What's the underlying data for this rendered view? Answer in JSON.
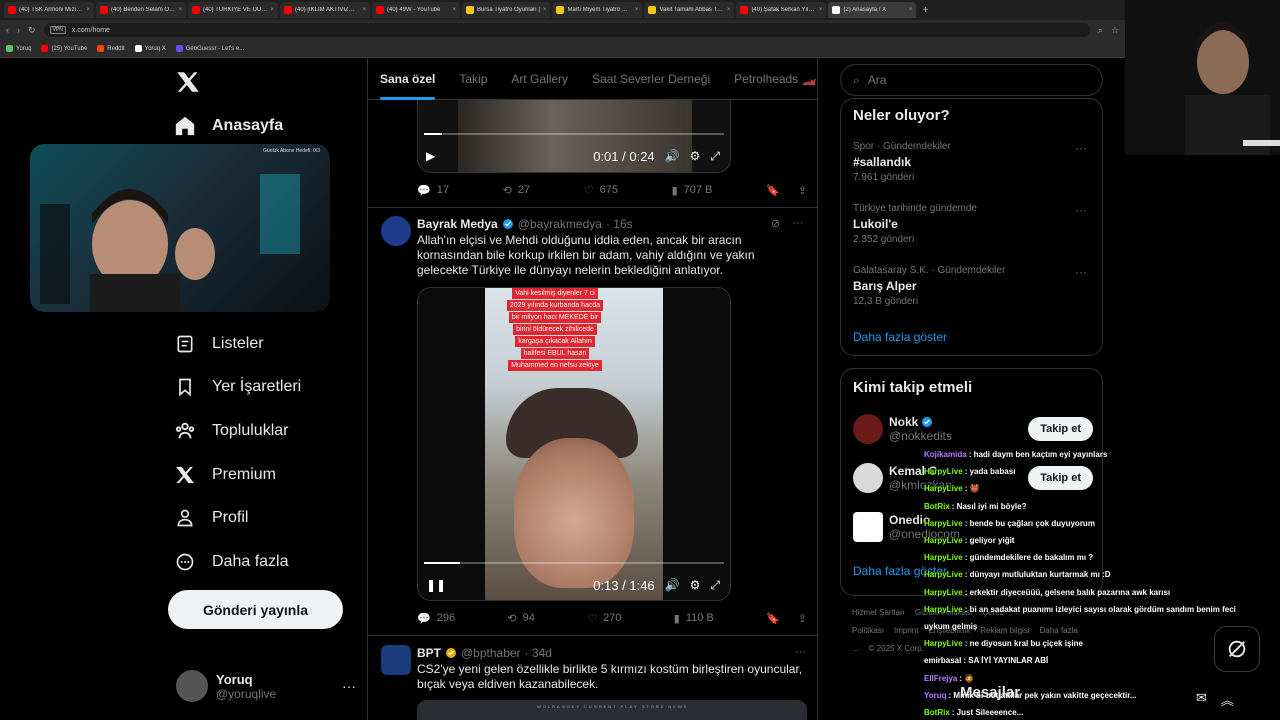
{
  "browser": {
    "tabs": [
      {
        "title": "(40) TSK Armoni Mızıkası",
        "color": "#ff0000"
      },
      {
        "title": "(40) Benden Selam Olsun",
        "color": "#ff0000"
      },
      {
        "title": "(40) TÜRKİYE VE DÜNYA",
        "color": "#ff0000"
      },
      {
        "title": "(40) [İKLİM AKTİVİZMİ] YA",
        "color": "#ff0000"
      },
      {
        "title": "(40) 49W - YouTube",
        "color": "#ff0000"
      },
      {
        "title": "Bursa Tiyatro Oyunları |",
        "color": "#f5c518"
      },
      {
        "title": "Martı Miyem Tiyatro Oyu",
        "color": "#f5c518"
      },
      {
        "title": "Vakit Tamam Abbas Tiyat",
        "color": "#f5c518"
      },
      {
        "title": "(40) Şafak Serkan Yılmaz",
        "color": "#ff0000"
      },
      {
        "title": "(2) Anasayfa / X",
        "color": "#ffffff"
      }
    ],
    "url": "x.com/home",
    "vpn_label": "VPN",
    "bookmarks": [
      {
        "label": "Yoruq",
        "color": "#5ec45e"
      },
      {
        "label": "(25) YouTube",
        "color": "#ff0000"
      },
      {
        "label": "Reddit",
        "color": "#ff4500"
      },
      {
        "label": "Yoruq X",
        "color": "#ffffff"
      },
      {
        "label": "GeoGuessr - Let's e...",
        "color": "#6b4ce6"
      }
    ]
  },
  "nav": {
    "home": "Anasayfa",
    "lists": "Listeler",
    "bookmarks": "Yer İşaretleri",
    "communities": "Topluluklar",
    "premium": "Premium",
    "profile": "Profil",
    "more": "Daha fazla",
    "post_button": "Gönderi yayınla"
  },
  "account": {
    "name": "Yoruq",
    "handle": "@yoruqlive"
  },
  "webcam": {
    "note": "Günlük Abone Hedefi: 0/3"
  },
  "feed_tabs": [
    "Sana özel",
    "Takip",
    "Art Gallery",
    "Saat Severler Derneği",
    "Petrolheads 🏎️"
  ],
  "tweet1": {
    "video_time": "0:01 / 0:24",
    "progress": 0.06,
    "replies": "17",
    "reposts": "27",
    "likes": "675",
    "views": "707 B"
  },
  "tweet2": {
    "name": "Bayrak Medya",
    "handle": "@bayrakmedya",
    "time": "· 16s",
    "text": "Allah'ın elçisi ve Mehdi olduğunu iddia eden, ancak bir aracın kornasından bile korkup irkilen bir adam, vahiy aldığını ve yakın gelecekte Türkiye ile dünyayı nelerin beklediğini anlatıyor.",
    "overlay_lines": [
      "Vahi kesilmiş diyenler 7 ci",
      "2029 yılında kurbanda hacda",
      "bir milyon hacı MEKEDE bir",
      "birini öldürecek zihilicede",
      "kargaşa çıkacak Allahın",
      "halifesi EBUL hasan",
      "Muhammed en nefsu zekiye"
    ],
    "video_time": "0:13 / 1:46",
    "progress": 0.12,
    "replies": "296",
    "reposts": "94",
    "likes": "270",
    "views": "110 B"
  },
  "tweet3": {
    "name": "BPT",
    "handle": "@bpthaber",
    "time": "· 34d",
    "text": "CS2'ye yeni gelen özellikle birlikte 5 kırmızı kostüm birleştiren oyuncular, bıçak veya eldiven kazanabilecek.",
    "strip": "WOLRANGEY  CURRENT  PLAY  STORE  NEWS"
  },
  "search": {
    "placeholder": "Ara"
  },
  "trends": {
    "title": "Neler oluyor?",
    "items": [
      {
        "context": "Spor · Gündemdekiler",
        "name": "#sallandık",
        "count": "7.961 gönderi"
      },
      {
        "context": "Türkiye tarihinde gündemde",
        "name": "Lukoil'e",
        "count": "2.352 gönderi"
      },
      {
        "context": "Galatasaray S.K. · Gündemdekiler",
        "name": "Barış Alper",
        "count": "12,3 B gönderi"
      }
    ],
    "show_more": "Daha fazla göster"
  },
  "who_to_follow": {
    "title": "Kimi takip etmeli",
    "follow_label": "Takip et",
    "items": [
      {
        "name": "Nokk",
        "handle": "@nokkedits",
        "color": "#6b1a1a"
      },
      {
        "name": "Kemal C",
        "handle": "@kmlozkan",
        "color": "#d9d9d9"
      },
      {
        "name": "Onedio",
        "handle": "@onediocom",
        "color": "#ffffff"
      }
    ],
    "show_more": "Daha fazla göster"
  },
  "footer": {
    "links": [
      "Hizmet Şartları",
      "Gizlilik Politikası",
      "Çerez Politikası",
      "Imprint",
      "Erişilebilirlik",
      "Reklam bilgisi",
      "Daha fazla ...",
      "© 2025 X Corp."
    ]
  },
  "chat": [
    {
      "user": "Kojikamida",
      "color": "#b87bff",
      "text": ": hadi daym ben kaçtım eyi yayınlars"
    },
    {
      "user": "HarpyLive",
      "color": "#7fff00",
      "text": ": yada babası"
    },
    {
      "user": "HarpyLive",
      "color": "#7fff00",
      "text": ": 👹"
    },
    {
      "user": "BotRix",
      "color": "#7fff00",
      "text": ": Nasıl iyi mi böyle?"
    },
    {
      "user": "HarpyLive",
      "color": "#7fff00",
      "text": ": bende bu çağları çok duyuyorum"
    },
    {
      "user": "HarpyLive",
      "color": "#7fff00",
      "text": ": geliyor yiğit"
    },
    {
      "user": "HarpyLive",
      "color": "#7fff00",
      "text": ": gündemdekilere de bakalım mı ?"
    },
    {
      "user": "HarpyLive",
      "color": "#7fff00",
      "text": ": dünyayı mutluluktan kurtarmak mı :D"
    },
    {
      "user": "HarpyLive",
      "color": "#7fff00",
      "text": ": erkektir diyeceüüü, gelsene balık pazarına awk karısı"
    },
    {
      "user": "HarpyLive",
      "color": "#7fff00",
      "text": ": bi an sadakat puanımı izleyici sayısı olarak gördüm sandım benim feci"
    },
    {
      "user": "",
      "color": "#ffffff",
      "text": "uykum gelmiş"
    },
    {
      "user": "HarpyLive",
      "color": "#7fff00",
      "text": ": ne diyosun kral bu çiçek işine"
    },
    {
      "user": "emirbasal",
      "color": "#ffffff",
      "text": ": SA İYİ YAYINLAR ABİ"
    },
    {
      "user": "EllFrejya",
      "color": "#b87bff",
      "text": ": 🧔"
    },
    {
      "user": "Yoruq",
      "color": "#b87bff",
      "text": ": Minik bi-bot attılar pek yakın vakitte geçecektir..."
    },
    {
      "user": "BotRix",
      "color": "#7fff00",
      "text": ": Just Sileeeence..."
    }
  ],
  "messages_label": "Mesajlar"
}
